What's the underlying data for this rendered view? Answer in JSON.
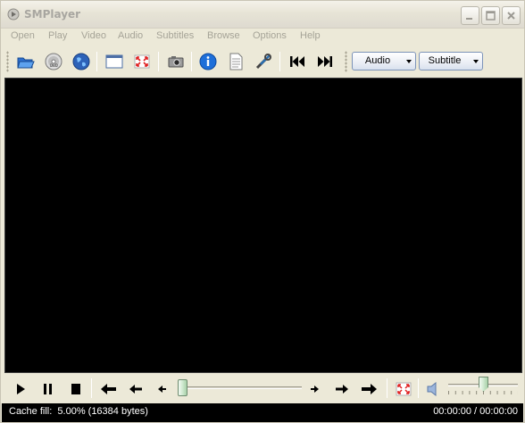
{
  "window": {
    "title": "SMPlayer"
  },
  "menu": {
    "items": [
      "Open",
      "Play",
      "Video",
      "Audio",
      "Subtitles",
      "Browse",
      "Options",
      "Help"
    ]
  },
  "toolbar": {
    "icons": [
      "open-folder-icon",
      "dvd-disc-icon",
      "open-url-globe-icon",
      "compact-mode-icon",
      "fullscreen-icon",
      "screenshot-camera-icon",
      "info-icon",
      "playlist-icon",
      "preferences-tools-icon",
      "previous-track-icon",
      "next-track-icon"
    ],
    "audio_combo": "Audio",
    "subtitle_combo": "Subtitle"
  },
  "controls": {
    "icons": [
      "play-icon",
      "pause-icon",
      "stop-icon",
      "rewind-long-icon",
      "rewind-medium-icon",
      "rewind-short-icon",
      "forward-short-icon",
      "forward-medium-icon",
      "forward-long-icon",
      "fullscreen-icon",
      "volume-icon"
    ],
    "seek_position": 0.0,
    "volume_level": 0.5
  },
  "status": {
    "cache": "Cache fill:  5.00% (16384 bytes)",
    "time": "00:00:00 / 00:00:00"
  },
  "colors": {
    "video_bg": "#000000",
    "statusbar_bg": "#000000",
    "info_blue": "#1e6fd9"
  }
}
